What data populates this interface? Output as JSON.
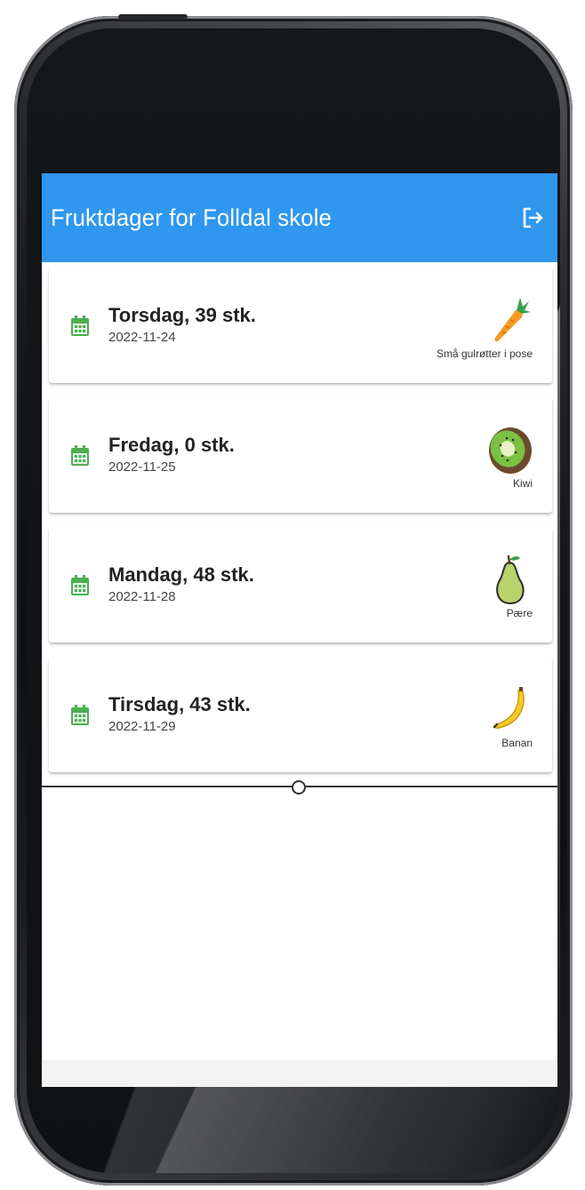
{
  "app_bar": {
    "title": "Fruktdager for Folldal skole",
    "logout_icon": "logout-icon",
    "color": "#2f97ee"
  },
  "days": [
    {
      "title": "Torsdag, 39 stk.",
      "date": "2022-11-24",
      "fruit": "Små gulrøtter i pose",
      "icon": "carrot-icon"
    },
    {
      "title": "Fredag, 0 stk.",
      "date": "2022-11-25",
      "fruit": "Kiwi",
      "icon": "kiwi-icon"
    },
    {
      "title": "Mandag, 48 stk.",
      "date": "2022-11-28",
      "fruit": "Pære",
      "icon": "pear-icon"
    },
    {
      "title": "Tirsdag, 43 stk.",
      "date": "2022-11-29",
      "fruit": "Banan",
      "icon": "banana-icon"
    }
  ],
  "colors": {
    "calendar_icon": "#4caf50"
  }
}
